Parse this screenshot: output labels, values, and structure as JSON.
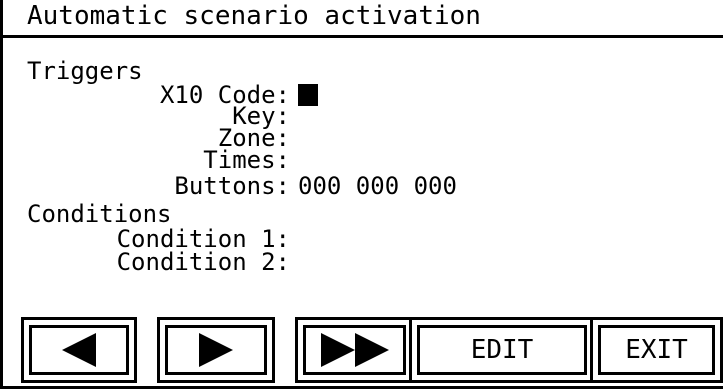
{
  "title": "Automatic scenario activation",
  "sections": {
    "triggers_heading": "Triggers",
    "conditions_heading": "Conditions"
  },
  "triggers": {
    "x10_code_label": "X10 Code:",
    "key_label": "Key:",
    "zone_label": "Zone:",
    "times_label": "Times:",
    "buttons_label": "Buttons:",
    "buttons_value": "000 000 000"
  },
  "conditions": {
    "condition1_label": "Condition 1:",
    "condition2_label": "Condition 2:"
  },
  "toolbar": {
    "prev_icon": "triangle-left-icon",
    "next_icon": "triangle-right-icon",
    "fast_forward_icon": "double-triangle-right-icon",
    "edit_label": "EDIT",
    "exit_label": "EXIT"
  }
}
